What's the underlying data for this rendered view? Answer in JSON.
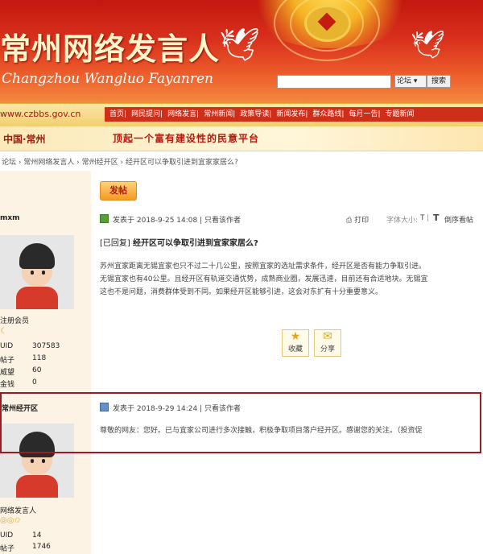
{
  "header": {
    "title": "常州网络发言人",
    "subtitle": "Changzhou Wangluo Fayanren",
    "search_placeholder": "",
    "search_scope": "论坛",
    "search_button": "搜索"
  },
  "nav": {
    "url": "www.czbbs.gov.cn",
    "items": [
      "首页",
      "网民提问",
      "网络发言",
      "常州新闻",
      "政策导读",
      "新闻发布",
      "群众路线",
      "每月一告",
      "专题新闻"
    ],
    "city": "中国·常州",
    "slogan": "顶起一个富有建设性的民意平台"
  },
  "breadcrumb": "论坛 › 常州网络发言人 › 常州经开区 › 经开区可以争取引进到宜家家居么?",
  "post_button": "发帖",
  "posts": [
    {
      "author": "mxm",
      "time": "发表于 2018-9-25 14:08",
      "only_author": "只看该作者",
      "print": "打印",
      "font_size": "字体大小:",
      "small_t": "T",
      "big_t": "T",
      "reverse": "倒序看帖",
      "title_tag": "[已回复]",
      "title": "经开区可以争取引进到宜家家居么?",
      "body": [
        "苏州宜家距离无锡宜家也只不过二十几公里，按照宜家的选址需求条件，经开区是否有能力争取引进。",
        "无锡宜家也有40公里。且经开区有轨道交通优势，成熟商业圈，发展迅速，目前还有合适地块。无锡宜",
        "这也不是问题，消费群体受到不同。如果经开区能够引进，这会对东扩有十分重要意义。"
      ],
      "role": "注册会员",
      "stats": [
        [
          "UID",
          "307583"
        ],
        [
          "帖子",
          "118"
        ],
        [
          "威望",
          "60"
        ],
        [
          "金钱",
          "0"
        ]
      ],
      "actions": [
        "收藏",
        "分享"
      ]
    },
    {
      "author": "常州经开区",
      "time": "发表于 2018-9-29 14:24",
      "only_author": "只看该作者",
      "body": [
        "尊敬的网友：您好。已与宜家公司进行多次接触，积极争取项目落户经开区。感谢您的关注。（投资促"
      ],
      "role": "网络发言人",
      "stats": [
        [
          "UID",
          "14"
        ],
        [
          "帖子",
          "1746"
        ]
      ]
    }
  ]
}
